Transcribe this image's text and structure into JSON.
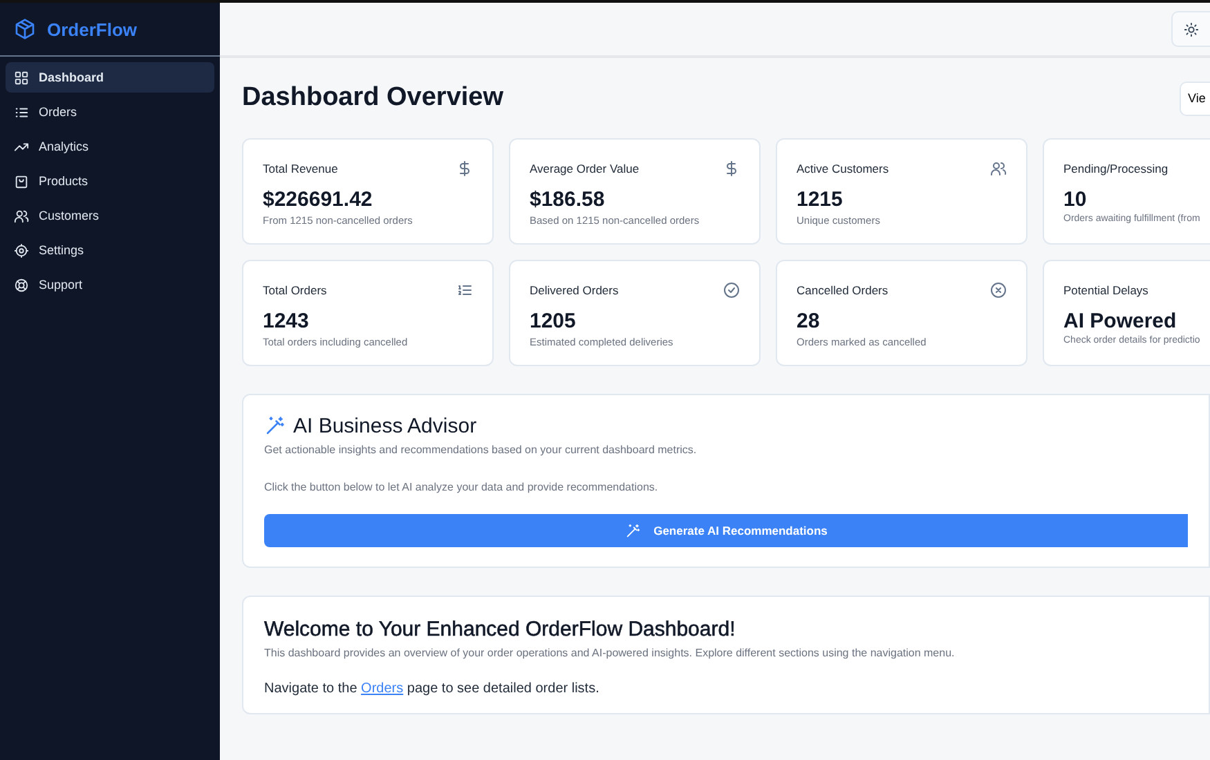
{
  "sidebar": {
    "brand": "OrderFlow",
    "items": [
      {
        "label": "Dashboard",
        "kind": "grid",
        "selected": true
      },
      {
        "label": "Orders",
        "kind": "list",
        "selected": false
      },
      {
        "label": "Analytics",
        "kind": "trend",
        "selected": false
      },
      {
        "label": "Products",
        "kind": "bag",
        "selected": false
      },
      {
        "label": "Customers",
        "kind": "users",
        "selected": false
      },
      {
        "label": "Settings",
        "kind": "gear",
        "selected": false
      },
      {
        "label": "Support",
        "kind": "lifebuoy",
        "selected": false
      }
    ]
  },
  "header": {
    "title": "Dashboard Overview",
    "button": "Vie"
  },
  "stats": [
    {
      "title": "Total Revenue",
      "value": "$226691.42",
      "note": "From 1215 non-cancelled orders",
      "kind": "dollar"
    },
    {
      "title": "Average Order Value",
      "value": "$186.58",
      "note": "Based on 1215 non-cancelled orders",
      "kind": "dollar"
    },
    {
      "title": "Active Customers",
      "value": "1215",
      "note": "Unique customers",
      "kind": "users"
    },
    {
      "title": "Pending/Processing",
      "value": "10",
      "note": "Orders awaiting fulfillment (from",
      "kind": "plain"
    },
    {
      "title": "Total Orders",
      "value": "1243",
      "note": "Total orders including cancelled",
      "kind": "list"
    },
    {
      "title": "Delivered Orders",
      "value": "1205",
      "note": "Estimated completed deliveries",
      "kind": "check"
    },
    {
      "title": "Cancelled Orders",
      "value": "28",
      "note": "Orders marked as cancelled",
      "kind": "cross"
    },
    {
      "title": "Potential Delays",
      "value": "AI Powered",
      "note": "Check order details for predictio",
      "kind": "plain"
    }
  ],
  "advisor": {
    "title": "AI Business Advisor",
    "subtitle": "Get actionable insights and recommendations based on your current dashboard metrics.",
    "hint": "Click the button below to let AI analyze your data and provide recommendations.",
    "button": "Generate AI Recommendations"
  },
  "welcome": {
    "title": "Welcome to Your Enhanced OrderFlow Dashboard!",
    "text": "This dashboard provides an overview of your order operations and AI-powered insights. Explore different sections using the navigation menu.",
    "nav_before": "Navigate to the",
    "link": "Orders",
    "nav_after": "page to see detailed order lists."
  }
}
